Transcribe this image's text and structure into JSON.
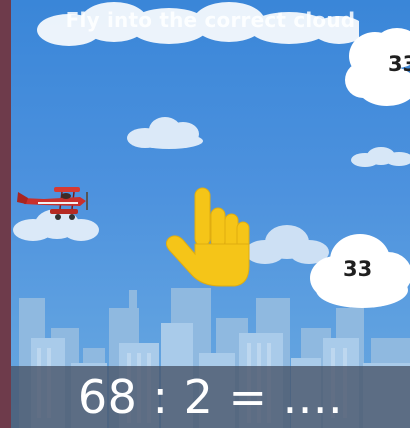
{
  "game": {
    "instruction": "Fly into the correct cloud",
    "equation": "68 : 2 = ....",
    "answers": [
      "33",
      "33"
    ]
  },
  "colors": {
    "sky": "#4d92de",
    "frame": "#6e3b4b",
    "plane": "#c9302c",
    "hand": "#f5c518",
    "equation_bar": "#465266"
  },
  "icons": {
    "player": "red-biplane-icon",
    "hint": "pointing-hand-icon"
  }
}
